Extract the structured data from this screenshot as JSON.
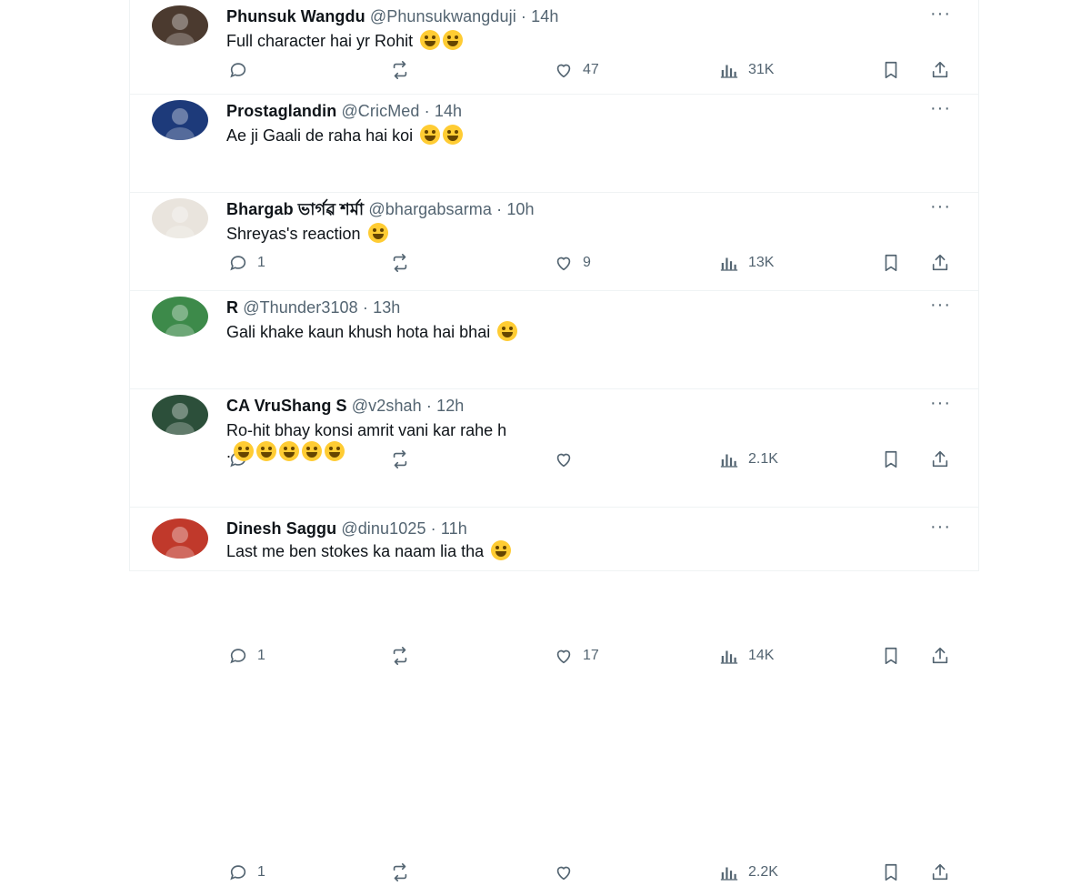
{
  "colors": {
    "text_primary": "#0f1419",
    "text_secondary": "#536471",
    "divider": "#eff3f4"
  },
  "tweets": [
    {
      "name": "Phunsuk Wangdu",
      "handle": "@Phunsukwangduji",
      "time": "14h",
      "text": "Full character hai yr Rohit",
      "text_line2": "",
      "emoji_count": 2,
      "replies": "",
      "retweets": "",
      "likes": "47",
      "views": "31K",
      "avatar_color": "#4b3a2f"
    },
    {
      "name": "Prostaglandin",
      "handle": "@CricMed",
      "time": "14h",
      "text": "Ae ji Gaali de raha hai koi",
      "text_line2": "",
      "emoji_count": 2,
      "replies": "1",
      "retweets": "",
      "likes": "9",
      "views": "13K",
      "avatar_color": "#1d3a7a"
    },
    {
      "name": "Bhargab ভাৰ্গৱ শৰ্মা",
      "handle": "@bhargabsarma",
      "time": "10h",
      "text": "Shreyas's reaction",
      "text_line2": "",
      "emoji_count": 1,
      "replies": "",
      "retweets": "",
      "likes": "",
      "views": "2.1K",
      "avatar_color": "#e9e4dd"
    },
    {
      "name": "R",
      "handle": "@Thunder3108",
      "time": "13h",
      "text": "Gali khake kaun khush hota hai bhai",
      "text_line2": "",
      "emoji_count": 1,
      "replies": "1",
      "retweets": "",
      "likes": "17",
      "views": "14K",
      "avatar_color": "#3d8a4a"
    },
    {
      "name": "CA VruShang S",
      "handle": "@v2shah",
      "time": "12h",
      "text": "Ro-hit bhay konsi amrit vani kar rahe h",
      "text_line2": ".",
      "emoji_count": 5,
      "replies": "1",
      "retweets": "",
      "likes": "",
      "views": "2.2K",
      "avatar_color": "#2c4f3a"
    },
    {
      "name": "Dinesh Saggu",
      "handle": "@dinu1025",
      "time": "11h",
      "text": "Last me ben stokes ka naam lia tha",
      "text_line2": "",
      "emoji_count": 1,
      "replies": "",
      "retweets": "",
      "likes": "",
      "views": "",
      "avatar_color": "#c0392b"
    }
  ],
  "ui": {
    "more_label": "···",
    "dot": "·"
  }
}
